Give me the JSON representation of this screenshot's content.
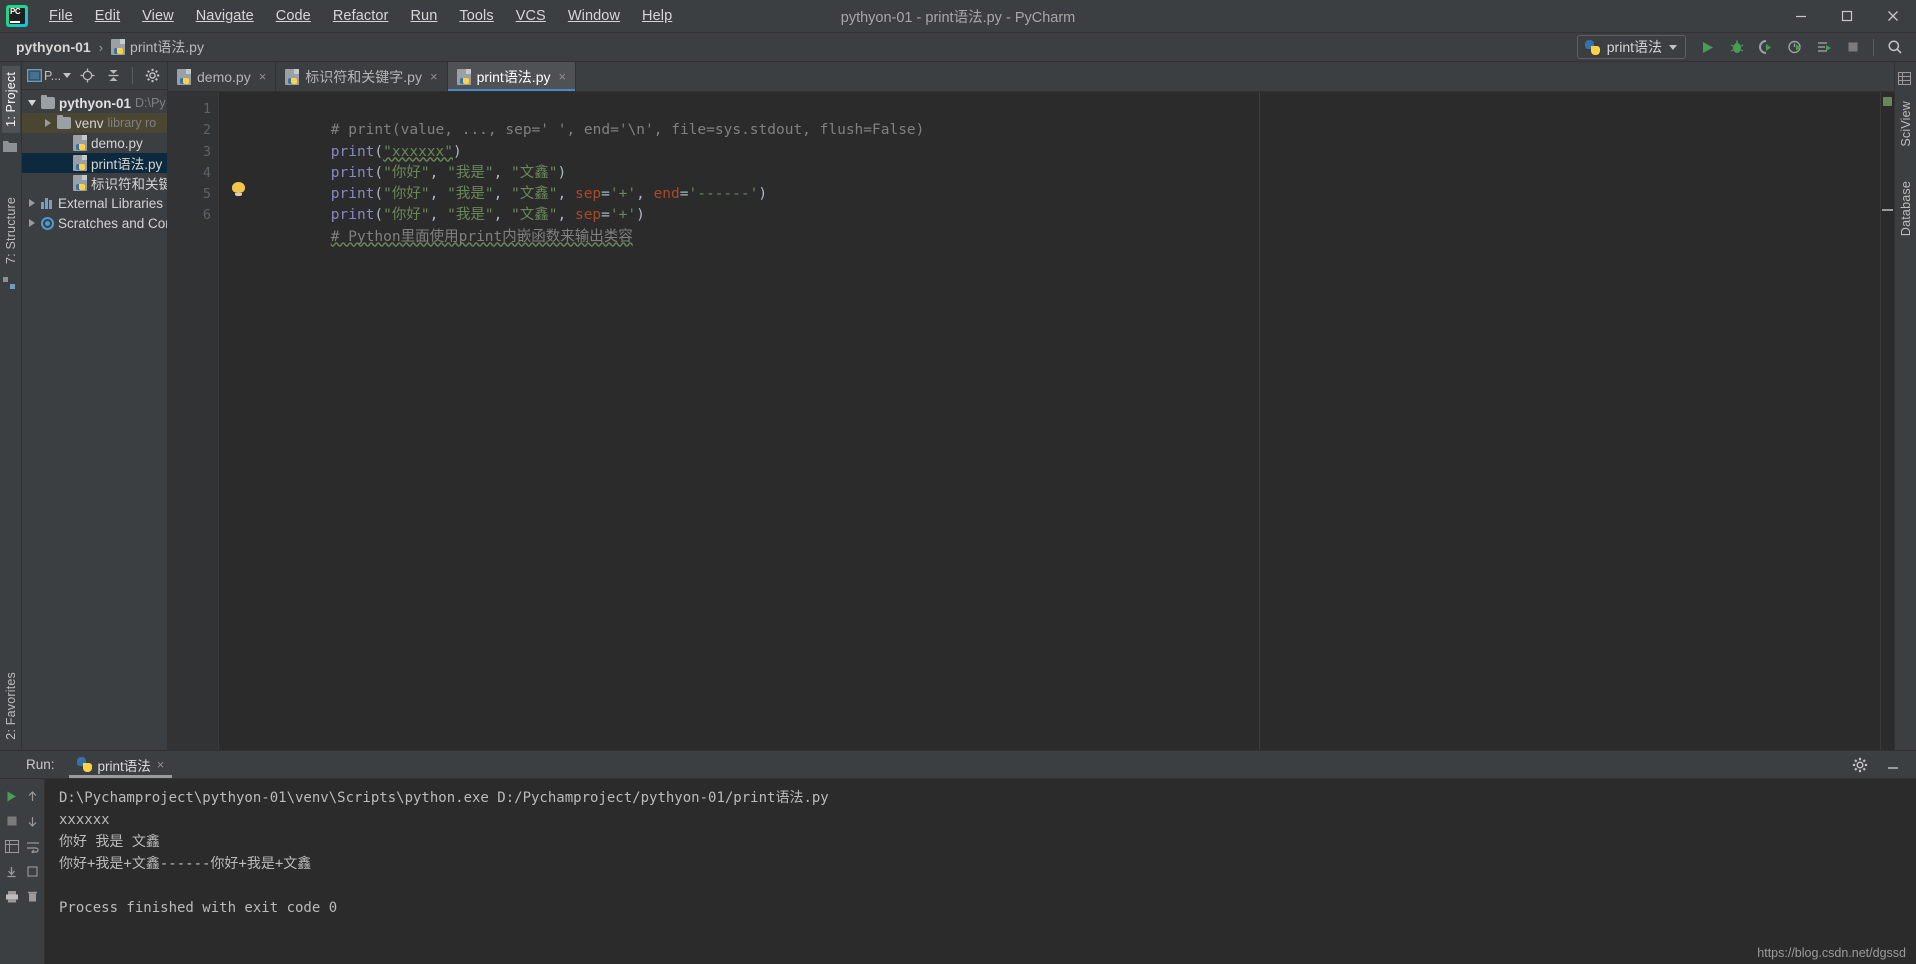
{
  "window": {
    "title": "pythyon-01 - print语法.py - PyCharm",
    "minimize_label": "minimize-window",
    "maximize_label": "maximize-window",
    "close_label": "close-window"
  },
  "menu": [
    {
      "label": "File"
    },
    {
      "label": "Edit"
    },
    {
      "label": "View"
    },
    {
      "label": "Navigate"
    },
    {
      "label": "Code"
    },
    {
      "label": "Refactor"
    },
    {
      "label": "Run"
    },
    {
      "label": "Tools"
    },
    {
      "label": "VCS"
    },
    {
      "label": "Window"
    },
    {
      "label": "Help"
    }
  ],
  "navbar": {
    "project_crumb": "pythyon-01",
    "separator": "›",
    "file_crumb": "print语法.py",
    "run_config": "print语法"
  },
  "toolbar_icons": [
    {
      "name": "run-icon"
    },
    {
      "name": "debug-icon"
    },
    {
      "name": "run-with-coverage-icon"
    },
    {
      "name": "profile-icon"
    },
    {
      "name": "run-anything-icon"
    },
    {
      "name": "stop-icon"
    },
    {
      "name": "search-everywhere-icon"
    }
  ],
  "left_tool_strip": [
    {
      "label": "1: Project",
      "active": true
    },
    {
      "label": "7: Structure",
      "active": false
    },
    {
      "label": "2: Favorites",
      "active": false
    }
  ],
  "right_tool_strip": [
    {
      "label": "SciView"
    },
    {
      "label": "Database"
    }
  ],
  "project_panel": {
    "selector_label": "P...",
    "tree": [
      {
        "indent": 0,
        "twisty": "down",
        "icon": "folder-icon",
        "label": "pythyon-01",
        "sub": "D:\\Py",
        "bold": true,
        "state": "normal"
      },
      {
        "indent": 1,
        "twisty": "right",
        "icon": "folder-icon",
        "label": "venv",
        "sub": "library ro",
        "bold": false,
        "state": "highlight"
      },
      {
        "indent": 2,
        "twisty": "none",
        "icon": "python-file-icon",
        "label": "demo.py",
        "sub": "",
        "bold": false,
        "state": "normal"
      },
      {
        "indent": 2,
        "twisty": "none",
        "icon": "python-file-icon",
        "label": "print语法.py",
        "sub": "",
        "bold": false,
        "state": "selected"
      },
      {
        "indent": 2,
        "twisty": "none",
        "icon": "python-file-icon",
        "label": "标识符和关键字.",
        "sub": "",
        "bold": false,
        "state": "normal"
      },
      {
        "indent": 0,
        "twisty": "right",
        "icon": "library-icon",
        "label": "External Libraries",
        "sub": "",
        "bold": false,
        "state": "normal"
      },
      {
        "indent": 0,
        "twisty": "right",
        "icon": "scratch-icon",
        "label": "Scratches and Cor",
        "sub": "",
        "bold": false,
        "state": "normal"
      }
    ]
  },
  "editor": {
    "tabs": [
      {
        "label": "demo.py",
        "active": false,
        "close": "×"
      },
      {
        "label": "标识符和关键字.py",
        "active": false,
        "close": "×"
      },
      {
        "label": "print语法.py",
        "active": true,
        "close": "×"
      }
    ],
    "line_numbers": [
      "1",
      "2",
      "3",
      "4",
      "5",
      "6"
    ],
    "code_lines": [
      {
        "num": "1",
        "text": "# print(value, ..., sep=' ', end='\\n', file=sys.stdout, flush=False)"
      },
      {
        "num": "2",
        "text": "print(\"xxxxxx\")"
      },
      {
        "num": "3",
        "text": "print(\"你好\", \"我是\", \"文鑫\")"
      },
      {
        "num": "4",
        "text": "print(\"你好\", \"我是\", \"文鑫\", sep='+', end='------')"
      },
      {
        "num": "5",
        "text": "print(\"你好\", \"我是\", \"文鑫\", sep='+')"
      },
      {
        "num": "6",
        "text": "# Python里面使用print内嵌函数来输出类容"
      }
    ],
    "code_tokens": {
      "l1_comment": "# print(value, ..., sep=' ', end='\\n', file=sys.stdout, flush=False)",
      "l2_fn": "print",
      "l2_open": "(",
      "l2_str": "\"xxxxxx\"",
      "l2_close": ")",
      "l3_fn": "print",
      "l3_open": "(",
      "l3_s1": "\"你好\"",
      "l3_c1": ", ",
      "l3_s2": "\"我是\"",
      "l3_c2": ", ",
      "l3_s3": "\"文鑫\"",
      "l3_close": ")",
      "l4_fn": "print",
      "l4_open": "(",
      "l4_s1": "\"你好\"",
      "l4_c1": ", ",
      "l4_s2": "\"我是\"",
      "l4_c2": ", ",
      "l4_s3": "\"文鑫\"",
      "l4_c3": ", ",
      "l4_sep": "sep",
      "l4_eq1": "=",
      "l4_sepv": "'+'",
      "l4_c4": ", ",
      "l4_end": "end",
      "l4_eq2": "=",
      "l4_endv": "'------'",
      "l4_close": ")",
      "l5_fn": "print",
      "l5_open": "(",
      "l5_s1": "\"你好\"",
      "l5_c1": ", ",
      "l5_s2": "\"我是\"",
      "l5_c2": ", ",
      "l5_s3": "\"文鑫\"",
      "l5_c3": ", ",
      "l5_sep": "sep",
      "l5_eq1": "=",
      "l5_sepv": "'+'",
      "l5_close": ")",
      "l6_comment": "# Python里面使用print内嵌函数来输出类容"
    },
    "intention_bulb": "intention-action-bulb"
  },
  "run_panel": {
    "title": "Run:",
    "tab_label": "print语法",
    "tab_close": "×",
    "console_lines": [
      "D:\\Pychamproject\\pythyon-01\\venv\\Scripts\\python.exe D:/Pychamproject/pythyon-01/print语法.py",
      "xxxxxx",
      "你好 我是 文鑫",
      "你好+我是+文鑫------你好+我是+文鑫",
      "",
      "Process finished with exit code 0"
    ],
    "sidebar_icons": [
      {
        "name": "rerun-icon"
      },
      {
        "name": "scroll-up-icon"
      },
      {
        "name": "stop-process-icon"
      },
      {
        "name": "scroll-down-icon"
      },
      {
        "name": "print-grid-icon"
      },
      {
        "name": "soft-wrap-icon"
      },
      {
        "name": "pin-tab-icon"
      },
      {
        "name": "scroll-to-end-icon"
      },
      {
        "name": "print-icon"
      },
      {
        "name": "trash-icon"
      }
    ],
    "settings_icon": "settings-gear-icon",
    "hide_icon": "hide-panel-icon"
  },
  "watermark": "https://blog.csdn.net/dgssd",
  "colors": {
    "bg_chrome": "#3c3f41",
    "bg_editor": "#2b2b2b",
    "accent_tab": "#4a88c7",
    "selection": "#0d293e",
    "string_green": "#6a8759",
    "function_purple": "#8888c6",
    "kwarg_orange": "#aa4926",
    "comment_gray": "#808080",
    "run_green": "#499c54"
  }
}
